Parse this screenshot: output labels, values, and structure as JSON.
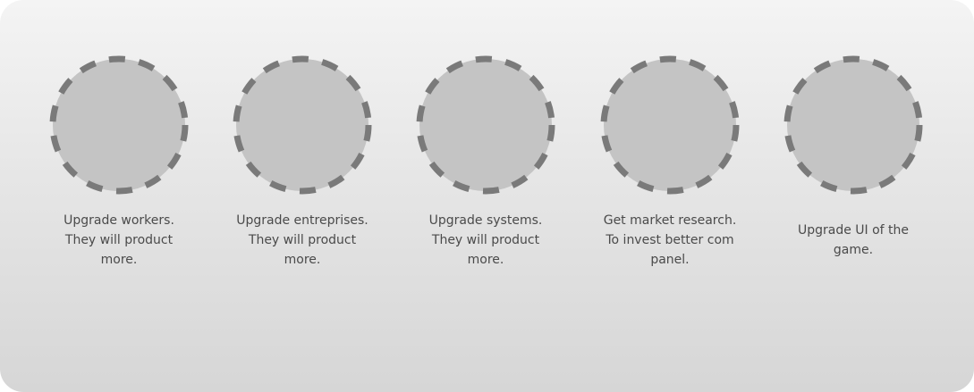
{
  "upgrades": [
    {
      "id": "workers",
      "description": "Upgrade workers. They will product more.",
      "icon": "dashed-circle-slot"
    },
    {
      "id": "entreprises",
      "description": "Upgrade entreprises. They will product more.",
      "icon": "dashed-circle-slot"
    },
    {
      "id": "systems",
      "description": "Upgrade systems. They will product more.",
      "icon": "dashed-circle-slot"
    },
    {
      "id": "market",
      "description": "Get market research. To invest better com panel.",
      "icon": "dashed-circle-slot"
    },
    {
      "id": "ui",
      "description": "Upgrade UI of the game.",
      "icon": "dashed-circle-slot"
    }
  ],
  "colors": {
    "slot_fill": "#c4c4c4",
    "slot_dash": "#7a7a7a",
    "caption_text": "#4a4a4a",
    "panel_top": "#f4f4f4",
    "panel_bottom": "#d6d6d6"
  }
}
